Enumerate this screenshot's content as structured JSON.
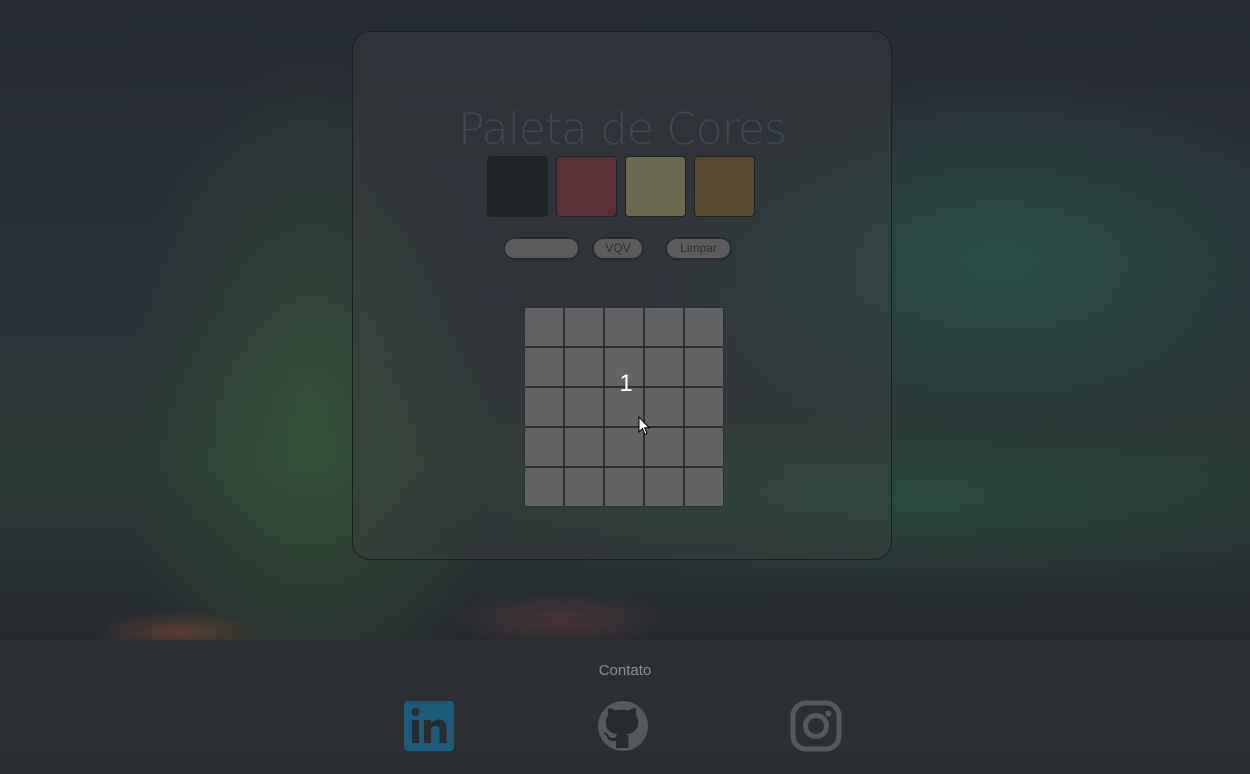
{
  "app": {
    "title": "Paleta de Cores"
  },
  "palette": {
    "colors": [
      "#1f2426",
      "#5a2f36",
      "#6c6a4e",
      "#5a4a30"
    ]
  },
  "controls": {
    "board_size_input_value": "",
    "vqv_label": "VQV",
    "clear_label": "Limpar"
  },
  "board": {
    "rows": 5,
    "columns": 5,
    "overlay_number": "1"
  },
  "footer": {
    "contact_label": "Contato",
    "links": [
      {
        "name": "linkedin",
        "icon": "linkedin-icon",
        "color": "#1d5b7a"
      },
      {
        "name": "github",
        "icon": "github-icon",
        "color": "#55595d"
      },
      {
        "name": "instagram",
        "icon": "instagram-icon",
        "color": "#55595d"
      }
    ]
  }
}
